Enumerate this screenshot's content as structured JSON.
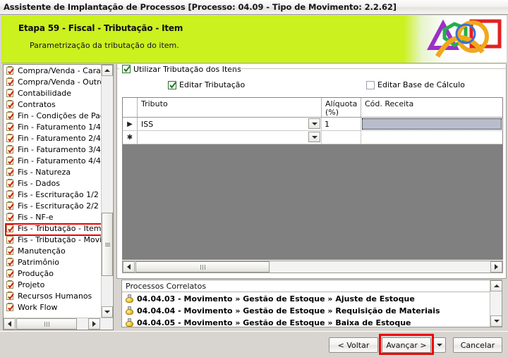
{
  "window": {
    "title": "Assistente de Implantação de Processos [Processo: 04.09 - Tipo de Movimento: 2.2.62]"
  },
  "banner": {
    "title": "Etapa 59 - Fiscal - Tributação - Item",
    "subtitle": "Parametrização da tributação do item.",
    "bg_color": "#cbf11f",
    "logo_name": "company-logo"
  },
  "sidebar": {
    "items": [
      {
        "label": "Compra/Venda - Caracte",
        "icon": "clipboard-check-icon"
      },
      {
        "label": "Compra/Venda - Outros",
        "icon": "clipboard-check-icon"
      },
      {
        "label": "Contabilidade",
        "icon": "clipboard-check-icon"
      },
      {
        "label": "Contratos",
        "icon": "clipboard-check-icon"
      },
      {
        "label": "Fin - Condições de Paga",
        "icon": "clipboard-check-icon"
      },
      {
        "label": "Fin - Faturamento 1/4",
        "icon": "clipboard-check-icon"
      },
      {
        "label": "Fin - Faturamento 2/4",
        "icon": "clipboard-check-icon"
      },
      {
        "label": "Fin - Faturamento 3/4",
        "icon": "clipboard-check-icon"
      },
      {
        "label": "Fin - Faturamento 4/4",
        "icon": "clipboard-check-icon"
      },
      {
        "label": "Fis - Natureza",
        "icon": "clipboard-check-icon"
      },
      {
        "label": "Fis - Dados",
        "icon": "clipboard-check-icon"
      },
      {
        "label": "Fis - Escrituração 1/2",
        "icon": "clipboard-check-icon"
      },
      {
        "label": "Fis - Escrituração 2/2",
        "icon": "clipboard-check-icon"
      },
      {
        "label": "Fis - NF-e",
        "icon": "clipboard-check-icon"
      },
      {
        "label": "Fis - Tributação - Item",
        "icon": "clipboard-check-icon"
      },
      {
        "label": "Fis - Tributação - Movim",
        "icon": "clipboard-check-icon"
      },
      {
        "label": "Manutenção",
        "icon": "clipboard-check-icon"
      },
      {
        "label": "Patrimônio",
        "icon": "clipboard-check-icon"
      },
      {
        "label": "Produção",
        "icon": "clipboard-check-icon"
      },
      {
        "label": "Projeto",
        "icon": "clipboard-check-icon"
      },
      {
        "label": "Recursos Humanos",
        "icon": "clipboard-check-icon"
      },
      {
        "label": "Work Flow",
        "icon": "clipboard-check-icon"
      }
    ],
    "highlighted_item_index": 14,
    "highlight_color": "#ee0000"
  },
  "main": {
    "group_checkbox": {
      "label": "Utilizar Tributação dos Itens",
      "checked": true
    },
    "checkboxes": [
      {
        "label": "Editar Tributação",
        "checked": true
      },
      {
        "label": "Editar Base de Cálculo",
        "checked": false
      }
    ],
    "grid": {
      "columns": [
        "Tributo",
        "Alíquota\n(%)",
        "Cód. Receita"
      ],
      "rows": [
        {
          "indicator": "▶",
          "tributo": "ISS",
          "aliquota": "1",
          "cod_receita": "",
          "selected_cell": "cod_receita"
        },
        {
          "indicator": "✱",
          "tributo": "",
          "aliquota": "",
          "cod_receita": "",
          "selected_cell": ""
        }
      ],
      "empty_area_color": "#808080"
    },
    "correlatos": {
      "header": "Processos Correlatos",
      "items": [
        {
          "label": "04.04.03 - Movimento » Gestão de Estoque » Ajuste de Estoque",
          "icon": "bell-icon"
        },
        {
          "label": "04.04.04 - Movimento » Gestão de Estoque » Requisição de Materiais",
          "icon": "bell-icon"
        },
        {
          "label": "04.04.05 - Movimento » Gestão de Estoque » Baixa de Estoque",
          "icon": "bell-icon"
        }
      ]
    }
  },
  "buttons": {
    "back": "< Voltar",
    "next": "Avançar >",
    "dropdown": "▼",
    "cancel": "Cancelar",
    "highlighted": "next",
    "highlight_color": "#ee0000"
  }
}
